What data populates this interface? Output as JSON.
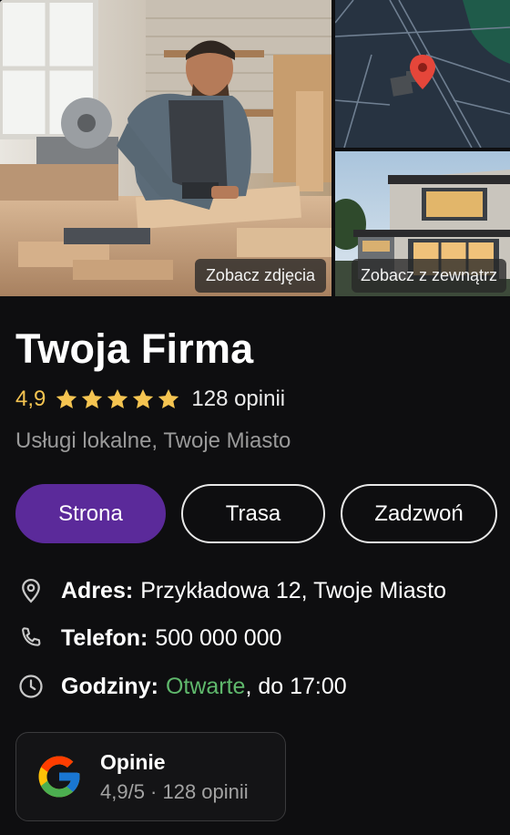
{
  "gallery": {
    "photos_label": "Zobacz zdjęcia",
    "exterior_label": "Zobacz z zewnątrz"
  },
  "business": {
    "name": "Twoja Firma",
    "rating": "4,9",
    "stars": 5,
    "reviews_text": "128 opinii",
    "category": "Usługi lokalne, Twoje Miasto"
  },
  "actions": {
    "website": "Strona",
    "route": "Trasa",
    "call": "Zadzwoń"
  },
  "info": {
    "address_label": "Adres:",
    "address_value": "Przykładowa 12, Twoje Miasto",
    "phone_label": "Telefon:",
    "phone_value": "500 000 000",
    "hours_label": "Godziny:",
    "hours_status": "Otwarte",
    "hours_rest": ", do 17:00"
  },
  "reviews_card": {
    "title": "Opinie",
    "subtitle": "4,9/5 · 128 opinii"
  },
  "colors": {
    "background": "#0e0e10",
    "primary_button": "#5b2a9a",
    "rating": "#f5c451",
    "open": "#5fb86c",
    "map_pin": "#e5463a"
  },
  "icons": {
    "address": "location-pin-icon",
    "phone": "phone-icon",
    "hours": "clock-icon",
    "reviews": "google-logo-icon",
    "star": "star-icon"
  }
}
